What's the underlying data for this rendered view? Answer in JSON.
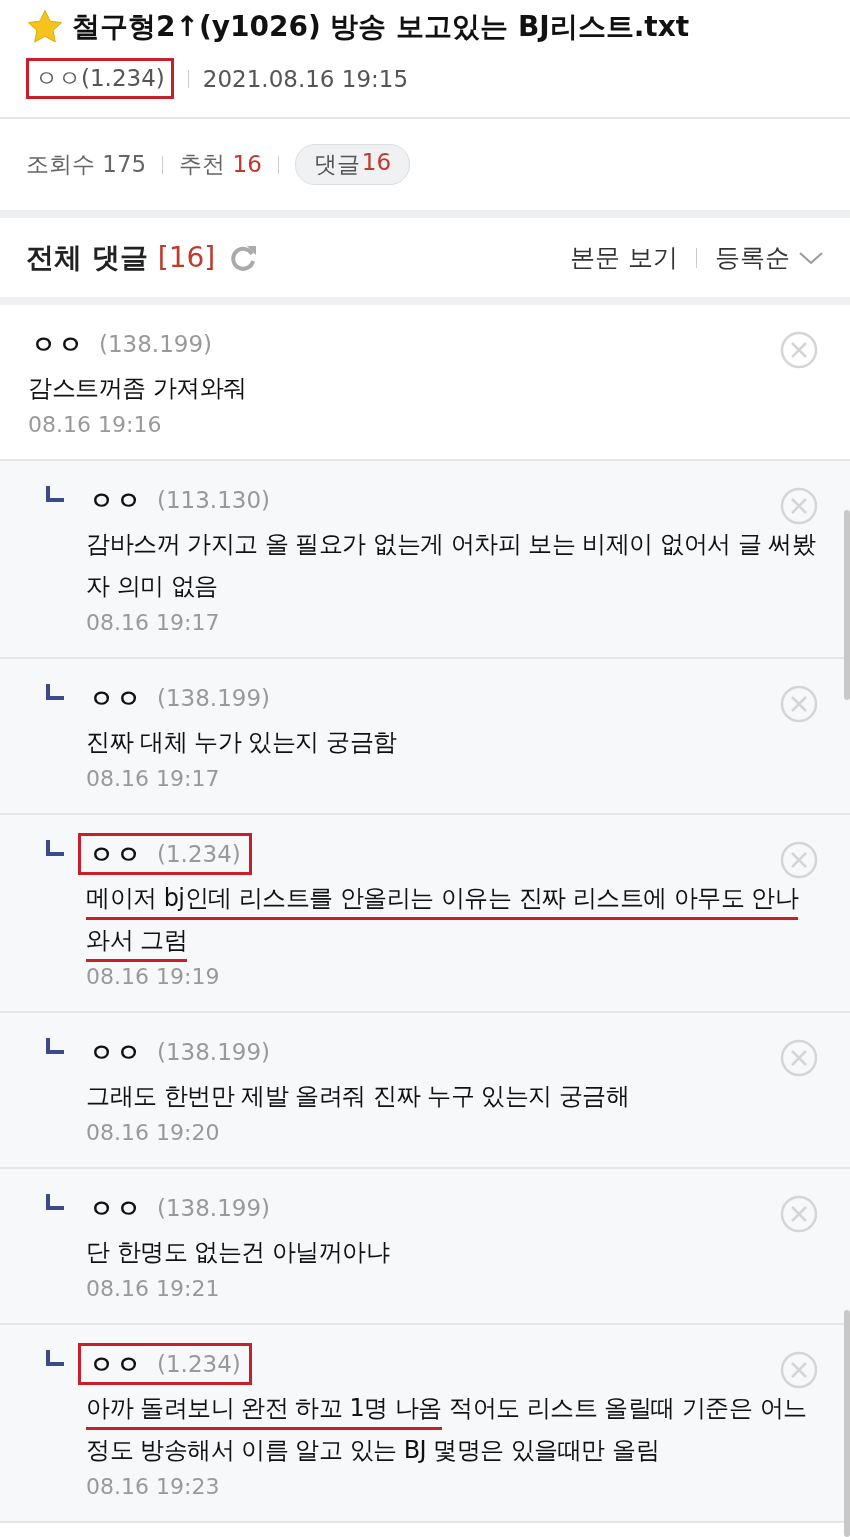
{
  "post": {
    "starred": true,
    "title": "철구형2↑(y1026) 방송 보고있는 BJ리스트.txt",
    "author": "ㅇㅇ(1.234)",
    "author_boxed": true,
    "date": "2021.08.16 19:15"
  },
  "stats": {
    "views_label": "조회수",
    "views": "175",
    "likes_label": "추천",
    "likes": "16",
    "comments_label": "댓글",
    "comments": "16"
  },
  "comments_header": {
    "title": "전체 댓글",
    "count": "[16]",
    "view_post": "본문 보기",
    "sort": "등록순"
  },
  "comments": [
    {
      "kind": "comment",
      "author": "ㅇㅇ",
      "ip": "(138.199)",
      "author_boxed": false,
      "text": [
        {
          "text": "감스트꺼좀 가져와줘",
          "underlined": false
        }
      ],
      "time": "08.16 19:16"
    },
    {
      "kind": "reply",
      "author": "ㅇㅇ",
      "ip": "(113.130)",
      "author_boxed": false,
      "text": [
        {
          "text": "감바스꺼 가지고 올 필요가 없는게 어차피 보는 비제이 없어서 글 써봤자 의미 없음",
          "underlined": false
        }
      ],
      "time": "08.16 19:17"
    },
    {
      "kind": "reply",
      "author": "ㅇㅇ",
      "ip": "(138.199)",
      "author_boxed": false,
      "text": [
        {
          "text": "진짜 대체 누가 있는지 궁금함",
          "underlined": false
        }
      ],
      "time": "08.16 19:17"
    },
    {
      "kind": "reply",
      "author": "ㅇㅇ",
      "ip": "(1.234)",
      "author_boxed": true,
      "text": [
        {
          "text": "메이저 bj인데 리스트를 안올리는 이유는 진짜 리스트에 아무도 안나와서 그럼",
          "underlined": true
        }
      ],
      "time": "08.16 19:19"
    },
    {
      "kind": "reply",
      "author": "ㅇㅇ",
      "ip": "(138.199)",
      "author_boxed": false,
      "text": [
        {
          "text": "그래도 한번만 제발 올려줘 진짜 누구 있는지 궁금해",
          "underlined": false
        }
      ],
      "time": "08.16 19:20"
    },
    {
      "kind": "reply",
      "author": "ㅇㅇ",
      "ip": "(138.199)",
      "author_boxed": false,
      "text": [
        {
          "text": "단 한명도 없는건 아닐꺼아냐",
          "underlined": false
        }
      ],
      "time": "08.16 19:21"
    },
    {
      "kind": "reply",
      "author": "ㅇㅇ",
      "ip": "(1.234)",
      "author_boxed": true,
      "text": [
        {
          "text": "아까 돌려보니 완전 하꼬 1명 나옴",
          "underlined": true
        },
        {
          "text": " 적어도 리스트 올릴때 기준은 어느정도 방송해서 이름 알고 있는 BJ 몇명은 있을때만 올림",
          "underlined": false
        }
      ],
      "time": "08.16 19:23"
    }
  ]
}
